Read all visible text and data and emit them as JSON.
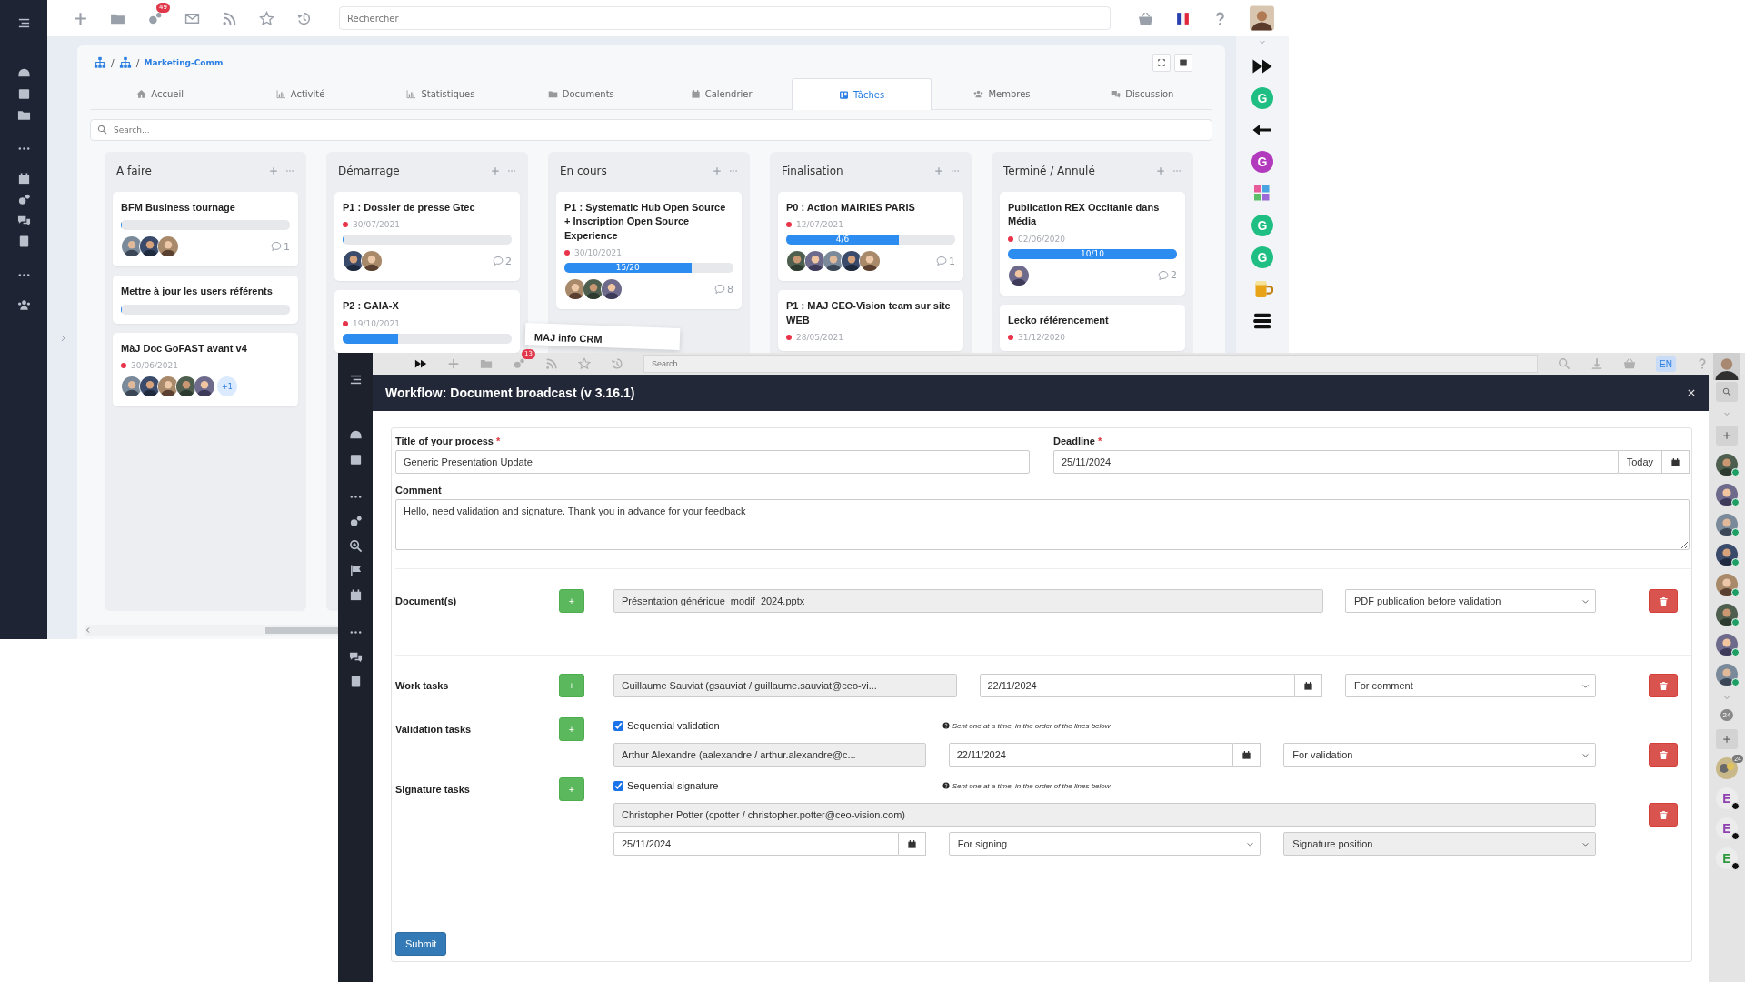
{
  "back": {
    "top_bar": {
      "notification_count": "49",
      "search": {
        "placeholder": "Rechercher"
      }
    },
    "breadcrumb": [
      {
        "kind": "icon"
      },
      {
        "kind": "separator",
        "text": "/"
      },
      {
        "kind": "icon"
      },
      {
        "kind": "separator",
        "text": "/"
      },
      {
        "kind": "link",
        "text": "Marketing-Comm"
      }
    ],
    "tabs": [
      {
        "label": "Accueil",
        "selected": false
      },
      {
        "label": "Activité",
        "selected": false
      },
      {
        "label": "Statistiques",
        "selected": false
      },
      {
        "label": "Documents",
        "selected": false
      },
      {
        "label": "Calendrier",
        "selected": false
      },
      {
        "label": "Tâches",
        "selected": true
      },
      {
        "label": "Membres",
        "selected": false
      },
      {
        "label": "Discussion",
        "selected": false
      }
    ],
    "board_search": {
      "placeholder": "Search..."
    },
    "columns": [
      {
        "title": "A faire",
        "cards": [
          {
            "title": "BFM Business tournage",
            "level": 0,
            "members": [
              {
                "kind": "photo"
              },
              {
                "kind": "photo"
              },
              {
                "kind": "photo"
              }
            ],
            "comments": "1"
          },
          {
            "title": "Mettre à jour les users référents",
            "level": 0
          },
          {
            "title": "MàJ Doc GoFAST avant v4",
            "date": "30/06/2021",
            "members": [
              {
                "kind": "photo"
              },
              {
                "kind": "photo"
              },
              {
                "kind": "photo"
              },
              {
                "kind": "photo"
              },
              {
                "kind": "photo"
              }
            ],
            "more_members": "+1"
          }
        ]
      },
      {
        "title": "Démarrage",
        "cards": [
          {
            "title": "P1 : Dossier de presse Gtec",
            "date": "30/07/2021",
            "level": 0,
            "members": [
              {
                "kind": "photo"
              },
              {
                "kind": "photo"
              }
            ],
            "comments": "2"
          },
          {
            "title": "P2 : GAIA-X",
            "date": "19/10/2021",
            "level": 0.33
          }
        ]
      },
      {
        "title": "En cours",
        "cards": [
          {
            "title": "P1 : Systematic Hub Open Source + Inscription Open Source Experience",
            "date": "30/10/2021",
            "level": 0.75,
            "progress": "15/20",
            "members": [
              {
                "kind": "photo"
              },
              {
                "kind": "photo"
              },
              {
                "kind": "photo"
              }
            ],
            "comments": "8"
          }
        ]
      },
      {
        "title": "Finalisation",
        "cards": [
          {
            "title": "P0 : Action MAIRIES PARIS",
            "date": "12/07/2021",
            "level": 0.667,
            "progress": "4/6",
            "members": [
              {
                "kind": "photo"
              },
              {
                "kind": "photo"
              },
              {
                "kind": "photo"
              },
              {
                "kind": "photo"
              },
              {
                "kind": "photo"
              }
            ],
            "comments": "1"
          },
          {
            "title": "P1 : MAJ CEO-Vision team sur site WEB",
            "date": "28/05/2021"
          }
        ]
      },
      {
        "title": "Terminé / Annulé",
        "cards": [
          {
            "title": "Publication REX Occitanie dans Média",
            "date": "02/06/2020",
            "level": 1,
            "progress": "10/10",
            "members": [
              {
                "kind": "photo"
              }
            ],
            "comments": "2"
          },
          {
            "title": "Lecko référencement",
            "date": "31/12/2020"
          }
        ]
      }
    ],
    "dragged_card": {
      "title": "MAJ info CRM"
    },
    "app_strip": [
      {
        "kind": "forward"
      },
      {
        "kind": "letter",
        "text": "G",
        "color": "#1fbf83"
      },
      {
        "kind": "logo"
      },
      {
        "kind": "letter",
        "text": "G",
        "color": "#b23bbd"
      },
      {
        "kind": "colorful"
      },
      {
        "kind": "letter",
        "text": "G",
        "color": "#1fbf83"
      },
      {
        "kind": "letter",
        "text": "G",
        "color": "#1fbf83"
      },
      {
        "kind": "mug"
      },
      {
        "kind": "books"
      }
    ]
  },
  "front": {
    "top_bar": {
      "notification_count": "13",
      "search": {
        "placeholder": "Search"
      },
      "language": "EN"
    },
    "modal": {
      "title": "Workflow: Document broadcast (v 3.16.1)",
      "process_title": {
        "label": "Title of your process",
        "required_mark": "*",
        "value": "Generic Presentation Update"
      },
      "deadline": {
        "label": "Deadline",
        "required_mark": "*",
        "value": "25/11/2024",
        "today_button": "Today"
      },
      "comment": {
        "label": "Comment",
        "value": "Hello, need validation and signature. Thank you in advance for your feedback"
      },
      "documents": {
        "label": "Document(s)",
        "add": "+",
        "rows": [
          {
            "file": "Présentation générique_modif_2024.pptx",
            "option": "PDF publication before validation"
          }
        ]
      },
      "work_tasks": {
        "label": "Work tasks",
        "add": "+",
        "rows": [
          {
            "person": "Guillaume Sauviat (gsauviat / guillaume.sauviat@ceo-vi...",
            "date": "22/11/2024",
            "option": "For comment"
          }
        ]
      },
      "validation_tasks": {
        "label": "Validation tasks",
        "add": "+",
        "sequential": {
          "label": "Sequential validation",
          "checked": true
        },
        "hint": "Sent one at a time, in the order of the lines below",
        "rows": [
          {
            "person": "Arthur Alexandre (aalexandre / arthur.alexandre@c...",
            "date": "22/11/2024",
            "option": "For validation"
          }
        ]
      },
      "signature_tasks": {
        "label": "Signature tasks",
        "add": "+",
        "sequential": {
          "label": "Sequential signature",
          "checked": true
        },
        "hint": "Sent one at a time, in the order of the lines below",
        "rows": [
          {
            "person": "Christopher Potter (cpotter / christopher.potter@ceo-vision.com)",
            "date": "25/11/2024",
            "option": "For signing",
            "position": "Signature position",
            "position_disabled": true
          }
        ]
      },
      "submit": "Submit"
    },
    "people_strip": [
      {
        "kind": "search"
      },
      {
        "kind": "chevron"
      },
      {
        "kind": "plus"
      },
      {
        "kind": "person",
        "online": true
      },
      {
        "kind": "person",
        "online": true
      },
      {
        "kind": "person",
        "online": true
      },
      {
        "kind": "person",
        "online": true
      },
      {
        "kind": "person",
        "online": true
      },
      {
        "kind": "person",
        "online": true
      },
      {
        "kind": "person",
        "online": true
      },
      {
        "kind": "person",
        "online": true
      },
      {
        "kind": "chevron"
      },
      {
        "kind": "count",
        "text": "24"
      },
      {
        "kind": "plus"
      },
      {
        "kind": "group",
        "text": "24"
      },
      {
        "kind": "letter",
        "text": "E",
        "color": "#8e3fb0",
        "online": false
      },
      {
        "kind": "letter",
        "text": "E",
        "color": "#8e3fb0",
        "online": false
      },
      {
        "kind": "letter",
        "text": "E",
        "color": "#2e9a3e",
        "online": false
      }
    ]
  }
}
